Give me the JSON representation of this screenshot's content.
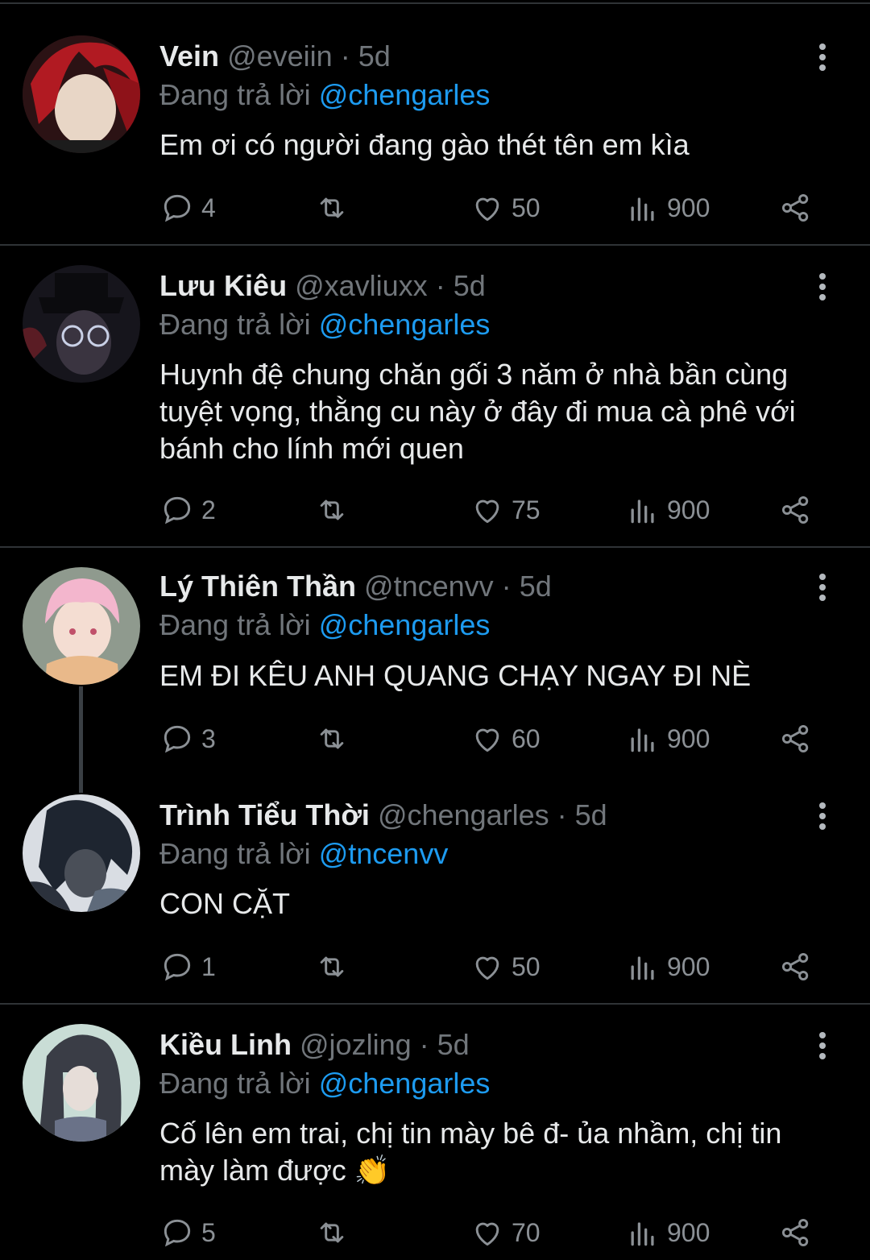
{
  "replying_label": "Đang trả lời",
  "tweets": [
    {
      "name": "Vein",
      "handle": "@eveiin",
      "dot": "·",
      "time": "5d",
      "reply_to": "@chengarles",
      "text": "Em ơi có người đang gào thét tên em kìa",
      "replies": "4",
      "likes": "50",
      "views": "900"
    },
    {
      "name": "Lưu Kiêu",
      "handle": "@xavliuxx",
      "dot": "·",
      "time": "5d",
      "reply_to": "@chengarles",
      "text": "Huynh đệ chung chăn gối 3 năm ở nhà bần cùng tuyệt vọng, thằng cu này ở đây đi mua cà phê với bánh cho lính mới quen",
      "replies": "2",
      "likes": "75",
      "views": "900"
    },
    {
      "name": "Lý Thiên Thần",
      "handle": "@tncenvv",
      "dot": "·",
      "time": "5d",
      "reply_to": "@chengarles",
      "text": "EM ĐI KÊU ANH QUANG CHẠY NGAY ĐI NÈ",
      "replies": "3",
      "likes": "60",
      "views": "900"
    },
    {
      "name": "Trình Tiểu Thời",
      "handle": "@chengarles",
      "dot": "·",
      "time": "5d",
      "reply_to": "@tncenvv",
      "text": "CON CẶT",
      "replies": "1",
      "likes": "50",
      "views": "900"
    },
    {
      "name": "Kiều Linh",
      "handle": "@jozling",
      "dot": "·",
      "time": "5d",
      "reply_to": "@chengarles",
      "text": "Cố lên em trai, chị tin mày bê đ- ủa nhầm, chị tin mày làm được 👏",
      "replies": "5",
      "likes": "70",
      "views": "900"
    }
  ],
  "colors": {
    "background": "#000000",
    "text": "#e7e9ea",
    "muted": "#71767b",
    "mention": "#1d9bf0",
    "divider": "#2f3336"
  },
  "icons": {
    "reply": "reply-icon",
    "retweet": "retweet-icon",
    "like": "heart-icon",
    "views": "views-icon",
    "share": "share-icon",
    "more": "more-icon"
  }
}
